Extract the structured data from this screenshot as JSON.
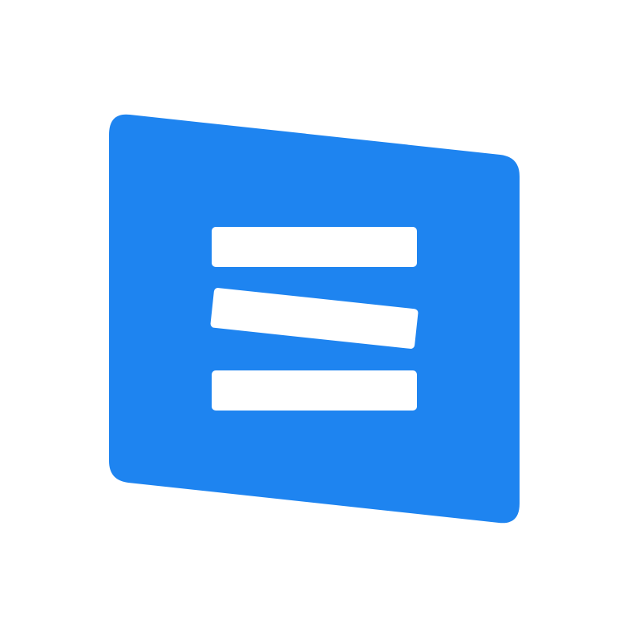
{
  "logo": {
    "icon": "parallelogram-document-lines-icon",
    "background_color": "#ffffff",
    "panel_color": "#1e84f0",
    "line_color": "#ffffff",
    "line_count": 3
  }
}
